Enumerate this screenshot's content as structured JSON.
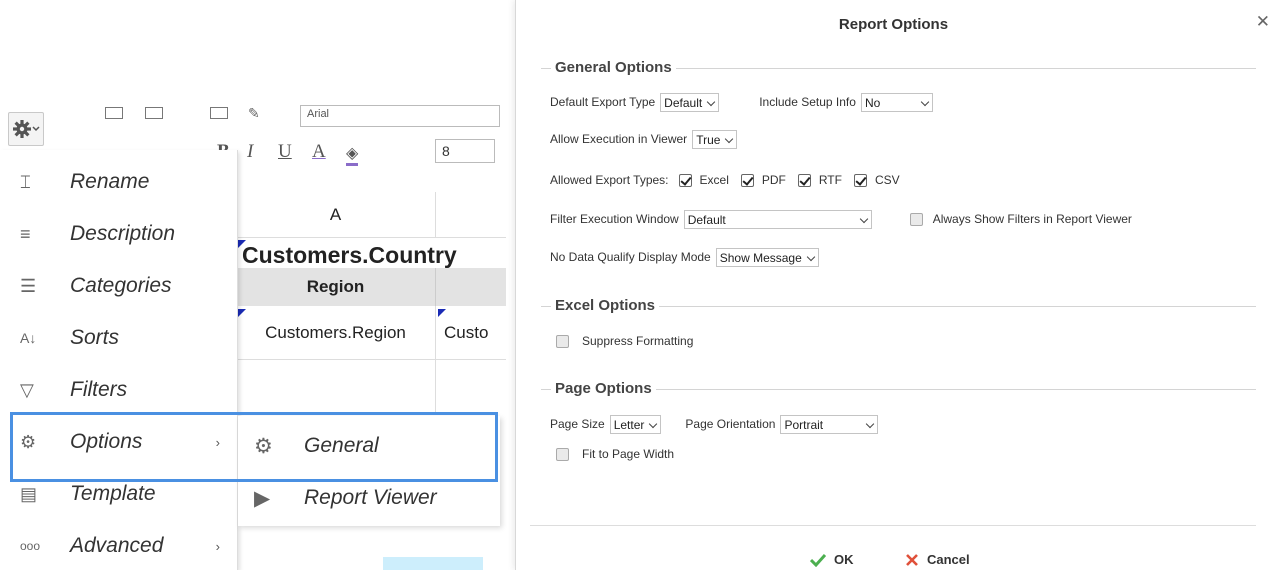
{
  "editor": {
    "font_name": "Arial",
    "font_size": "8",
    "format_bold": "B",
    "format_italic": "I",
    "format_underline": "U",
    "format_color": "A",
    "column_header": "A",
    "cell_title": "Customers.Country",
    "region_header": "Region",
    "region_cell": "Customers.Region",
    "region_cell2": "Custo"
  },
  "menu": {
    "items": [
      {
        "label": "Rename",
        "icon": "rename-icon"
      },
      {
        "label": "Description",
        "icon": "description-icon"
      },
      {
        "label": "Categories",
        "icon": "categories-icon"
      },
      {
        "label": "Sorts",
        "icon": "sort-az-icon"
      },
      {
        "label": "Filters",
        "icon": "filter-icon"
      },
      {
        "label": "Options",
        "icon": "gear-icon",
        "has_submenu": true
      },
      {
        "label": "Template",
        "icon": "template-icon"
      },
      {
        "label": "Advanced",
        "icon": "dots-icon",
        "has_submenu": true
      }
    ],
    "arrow": "›",
    "submenu": [
      {
        "label": "General",
        "icon": "gear-icon"
      },
      {
        "label": "Report Viewer",
        "icon": "play-circle-icon"
      }
    ]
  },
  "dialog": {
    "title": "Report Options",
    "close": "✕",
    "general": {
      "heading": "General Options",
      "default_export_type_label": "Default Export Type",
      "default_export_type_value": "Default",
      "include_setup_info_label": "Include Setup Info",
      "include_setup_info_value": "No",
      "allow_execution_label": "Allow Execution in Viewer",
      "allow_execution_value": "True",
      "allowed_export_types_label": "Allowed Export Types:",
      "export_types": [
        {
          "label": "Excel",
          "checked": true
        },
        {
          "label": "PDF",
          "checked": true
        },
        {
          "label": "RTF",
          "checked": true
        },
        {
          "label": "CSV",
          "checked": true
        }
      ],
      "filter_window_label": "Filter Execution Window",
      "filter_window_value": "Default",
      "always_show_filters_label": "Always Show Filters in Report Viewer",
      "no_data_label": "No Data Qualify Display Mode",
      "no_data_value": "Show Message"
    },
    "excel": {
      "heading": "Excel Options",
      "suppress_formatting_label": "Suppress Formatting"
    },
    "page": {
      "heading": "Page Options",
      "page_size_label": "Page Size",
      "page_size_value": "Letter",
      "page_orientation_label": "Page Orientation",
      "page_orientation_value": "Portrait",
      "fit_width_label": "Fit to Page Width"
    },
    "footer": {
      "ok_label": "OK",
      "cancel_label": "Cancel"
    }
  },
  "colors": {
    "highlight": "#4a90e2",
    "ok_green": "#4caf50",
    "cancel_red": "#e0503a",
    "cell_marker": "#1a2bb5"
  }
}
